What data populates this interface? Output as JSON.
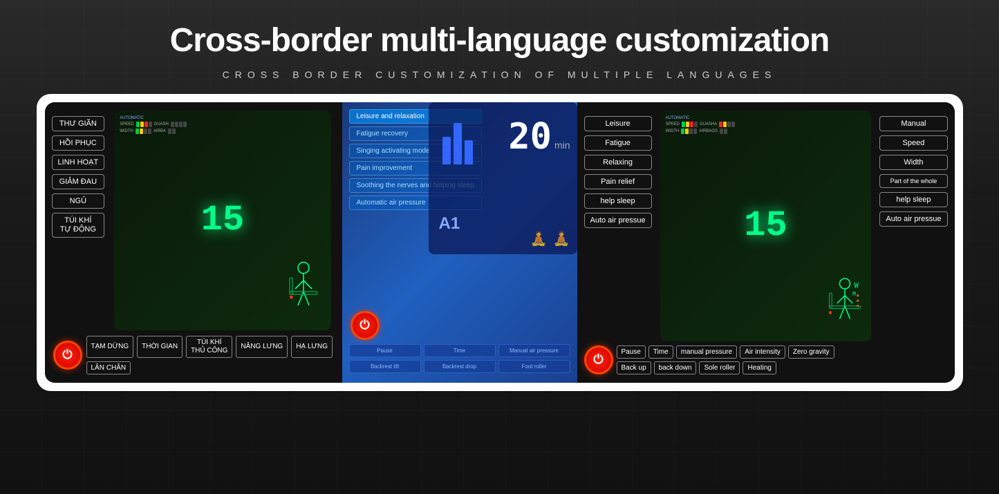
{
  "header": {
    "main_title": "Cross-border multi-language customization",
    "sub_title": "CROSS BORDER CUSTOMIZATION OF MULTIPLE LANGUAGES"
  },
  "viet_panel": {
    "mode_buttons": [
      "THƯ GIÃN",
      "HỒI PHỤC",
      "LINH HOẠT",
      "GIẢM ĐAU",
      "NGỦ",
      "TÚI KHÍ TỰ ĐỘNG"
    ],
    "screen_number": "15",
    "speed_label": "AUTOMATIC",
    "speed_text": "SPEED",
    "width_text": "WIDTH",
    "guasha_text": "GUASH",
    "airbags_text": "AIRBA",
    "bottom_buttons": [
      "TẠM DỪNG",
      "THỜI GIAN",
      "TÚI KHÍ THỦ CÔNG",
      "NÂNG LƯNG",
      "HẠ LƯNG",
      "LĂN CHÂN"
    ]
  },
  "blue_panel": {
    "mode_items": [
      "Leisure and relaxation",
      "Fatigue recovery",
      "Singing activating mode",
      "Pain improvement",
      "Soothing the nerves and helping sleep",
      "Automatic air pressure"
    ],
    "timer": "20",
    "timer_unit": "min",
    "a1_label": "A1",
    "bottom_row1": [
      "Pause",
      "Time",
      "Manual air pressure"
    ],
    "bottom_row2": [
      "Backrest lift",
      "Backrest drop",
      "Foot roller"
    ]
  },
  "eng_panel": {
    "mode_buttons": [
      "Leisure",
      "Fatigue",
      "Relaxing",
      "Pain relief",
      "help sleep",
      "Auto air pressue"
    ],
    "screen_number": "15",
    "speed_label": "AUTOMATIC",
    "speed_text": "SPEED",
    "width_text": "WIDTH",
    "guasha_text": "GUASHA",
    "airbags_text": "AIRBAGS",
    "right_buttons": [
      "Manual",
      "Speed",
      "Width",
      "Part of the whole",
      "help sleep",
      "Auto air pressue"
    ],
    "bottom_row1": [
      "Pause",
      "Time",
      "manual pressure",
      "Air intensity",
      "Zero gravity"
    ],
    "bottom_row2": [
      "Back up",
      "back down",
      "Sole roller",
      "Heating"
    ]
  },
  "colors": {
    "accent_green": "#00ff88",
    "accent_red": "#ff2200",
    "accent_blue": "#2060c0",
    "text_white": "#ffffff",
    "border_gray": "#888888"
  }
}
